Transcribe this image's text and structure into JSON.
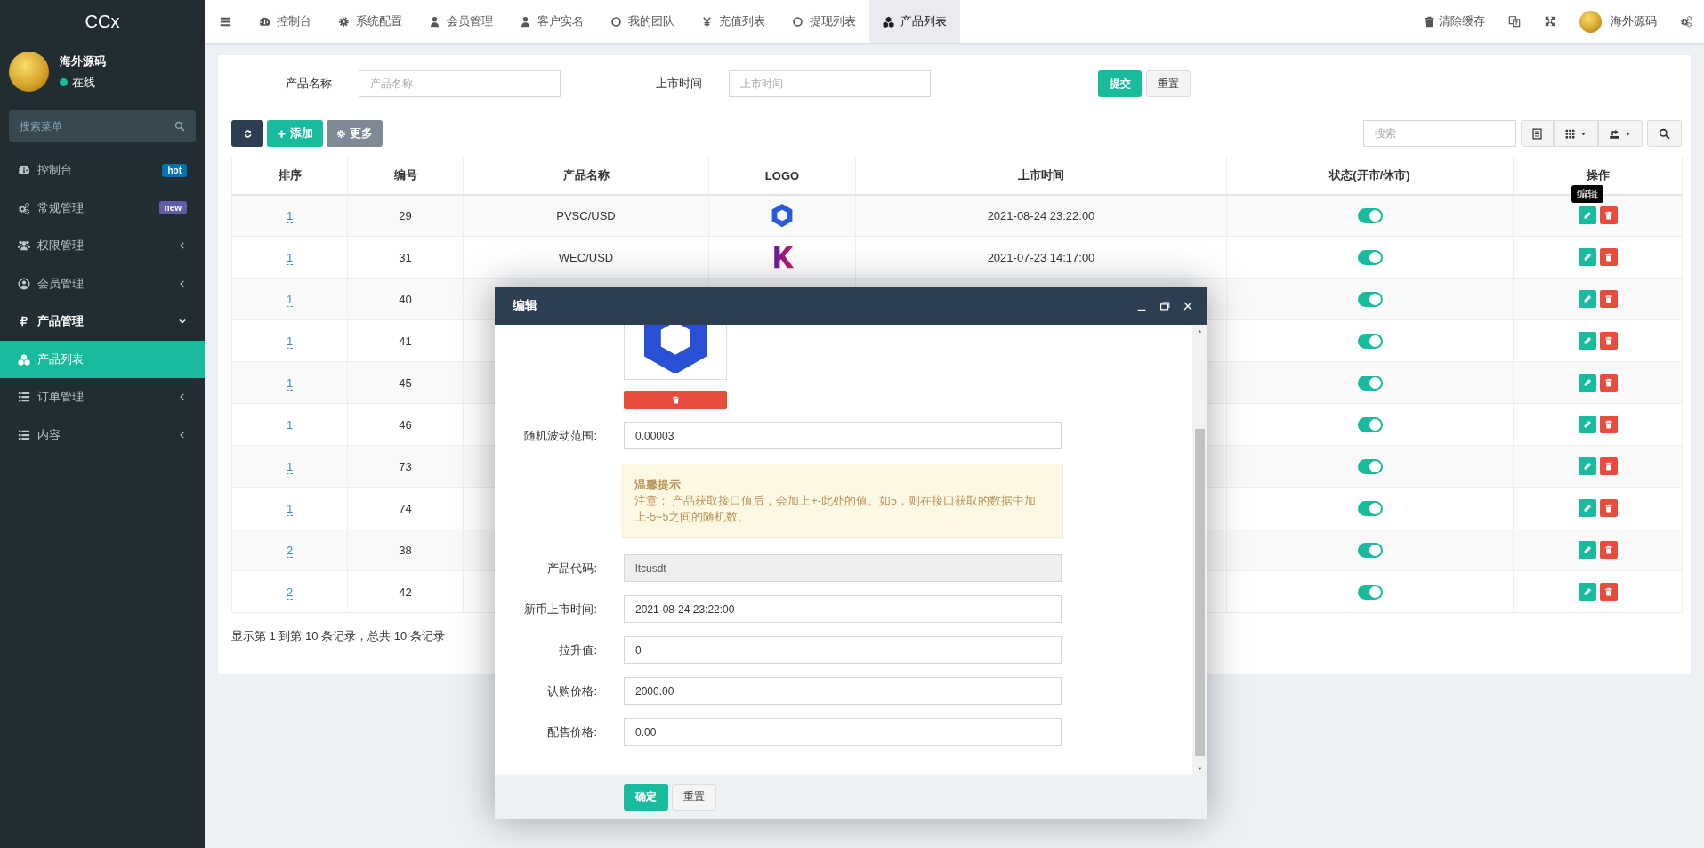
{
  "sidebar": {
    "title": "CCx",
    "user": {
      "name": "海外源码",
      "status": "在线",
      "online": true
    },
    "search": {
      "placeholder": "搜索菜单"
    },
    "items": [
      {
        "label": "控制台",
        "selected": false,
        "badge": {
          "text": "hot",
          "color": "#0073b7"
        }
      },
      {
        "label": "常规管理",
        "selected": false,
        "badge": {
          "text": "new",
          "color": "#605ca8"
        }
      },
      {
        "label": "权限管理",
        "selected": false,
        "expanded": false
      },
      {
        "label": "会员管理",
        "selected": false,
        "expanded": false
      },
      {
        "label": "产品管理",
        "selected": false,
        "expanded": true,
        "children": [
          {
            "label": "产品列表",
            "selected": true
          }
        ]
      },
      {
        "label": "订单管理",
        "selected": false,
        "expanded": false
      },
      {
        "label": "内容",
        "selected": false,
        "expanded": false
      }
    ]
  },
  "topbar": {
    "tabs": [
      {
        "label": "控制台",
        "selected": false
      },
      {
        "label": "系统配置",
        "selected": false
      },
      {
        "label": "会员管理",
        "selected": false
      },
      {
        "label": "客户实名",
        "selected": false
      },
      {
        "label": "我的团队",
        "selected": false
      },
      {
        "label": "充值列表",
        "selected": false
      },
      {
        "label": "提现列表",
        "selected": false
      },
      {
        "label": "产品列表",
        "selected": true
      }
    ],
    "clear_cache": "清除缓存",
    "user": "海外源码"
  },
  "filter": {
    "fields": [
      {
        "label": "产品名称",
        "placeholder": "产品名称"
      },
      {
        "label": "上市时间",
        "placeholder": "上市时间"
      }
    ],
    "buttons": [
      "提交",
      "重置"
    ]
  },
  "toolbar": {
    "add": "添加",
    "more": "更多",
    "search_placeholder": "搜索"
  },
  "table": {
    "columns": [
      "排序",
      "编号",
      "产品名称",
      "LOGO",
      "上市时间",
      "状态(开市/休市)",
      "操作"
    ],
    "tooltip": "编辑",
    "rows": [
      {
        "sort": "1",
        "id": "29",
        "name": "PVSC/USD",
        "time": "2021-08-24 23:22:00",
        "status_on": true
      },
      {
        "sort": "1",
        "id": "31",
        "name": "WEC/USD",
        "time": "2021-07-23 14:17:00",
        "status_on": true
      },
      {
        "sort": "1",
        "id": "40",
        "status_on": true
      },
      {
        "sort": "1",
        "id": "41",
        "status_on": true
      },
      {
        "sort": "1",
        "id": "45",
        "status_on": true
      },
      {
        "sort": "1",
        "id": "46",
        "status_on": true
      },
      {
        "sort": "1",
        "id": "73",
        "status_on": true
      },
      {
        "sort": "1",
        "id": "74",
        "status_on": true
      },
      {
        "sort": "2",
        "id": "38",
        "status_on": true
      },
      {
        "sort": "2",
        "id": "42",
        "status_on": true
      }
    ]
  },
  "pagination_text": "显示第 1 到第 10 条记录，总共 10 条记录",
  "dialog": {
    "title": "编辑",
    "fields": [
      {
        "kind": "field",
        "label": "随机波动范围:",
        "value": "0.00003",
        "disabled": false
      },
      {
        "kind": "notice",
        "title": "温馨提示",
        "text": "注意： 产品获取接口值后，会加上+-此处的值。如5，则在接口获取的数据中加上-5~5之间的随机数。"
      },
      {
        "kind": "field",
        "label": "产品代码:",
        "value": "ltcusdt",
        "disabled": true
      },
      {
        "kind": "field",
        "label": "新币上市时间:",
        "value": "2021-08-24 23:22:00",
        "disabled": false
      },
      {
        "kind": "field",
        "label": "拉升值:",
        "value": "0",
        "disabled": false
      },
      {
        "kind": "field",
        "label": "认购价格:",
        "value": "2000.00",
        "disabled": false
      },
      {
        "kind": "field",
        "label": "配售价格:",
        "value": "0.00",
        "disabled": false
      }
    ],
    "buttons": [
      "确定",
      "重置"
    ]
  }
}
